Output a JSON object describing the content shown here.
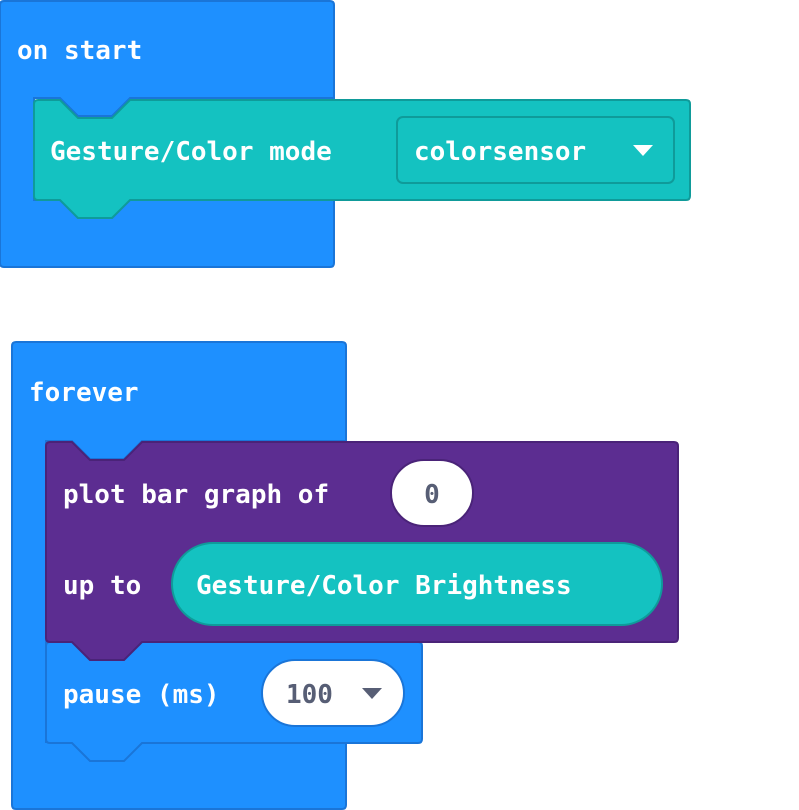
{
  "blocks": {
    "on_start": {
      "label": "on start",
      "gesture_mode": {
        "label": "Gesture/Color mode",
        "dropdown_value": "colorsensor"
      }
    },
    "forever": {
      "label": "forever",
      "plot_bar_graph": {
        "label_of": "plot bar graph of",
        "value": "0",
        "label_up_to": "up to",
        "up_to_reporter": "Gesture/Color Brightness"
      },
      "pause": {
        "label": "pause (ms)",
        "value": "100"
      }
    }
  },
  "colors": {
    "basic_blue": "#1e90ff",
    "sensor_teal": "#14c2c1",
    "led_purple": "#5c2d91",
    "stroke_blue": "#1a75d8",
    "stroke_teal": "#0f9b9a",
    "stroke_purple": "#4a2378"
  }
}
